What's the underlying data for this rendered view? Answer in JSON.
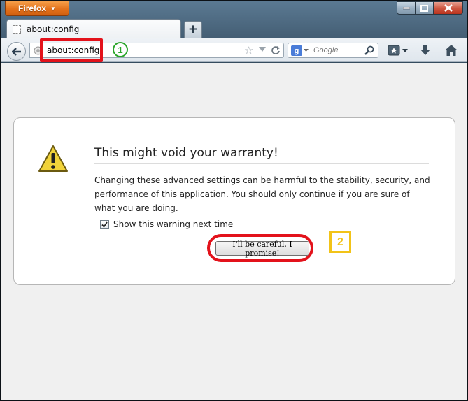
{
  "titlebar": {
    "app_button_label": "Firefox",
    "controls": [
      "minimize-icon",
      "maximize-icon",
      "close-icon"
    ]
  },
  "tabs": [
    {
      "label": "about:config",
      "icon": "blank-page-icon"
    }
  ],
  "new_tab_label": "+",
  "navbar": {
    "url": "about:config",
    "search_engine": "g",
    "search_placeholder": "Google"
  },
  "dialog": {
    "title": "This might void your warranty!",
    "body": "Changing these advanced settings can be harmful to the stability, security, and performance of this application. You should only continue if you are sure of what you are doing.",
    "checkbox_label": "Show this warning next time",
    "checkbox_checked": true,
    "button_label": "I'll be careful, I promise!"
  },
  "annotations": {
    "step1": "1",
    "step2": "2",
    "highlight_color": "#e3121b",
    "step1_color": "#2aa52a",
    "step2_color": "#f2c318"
  },
  "colors": {
    "firefox_button": "#e3721c",
    "page_background": "#f0f0f0"
  }
}
